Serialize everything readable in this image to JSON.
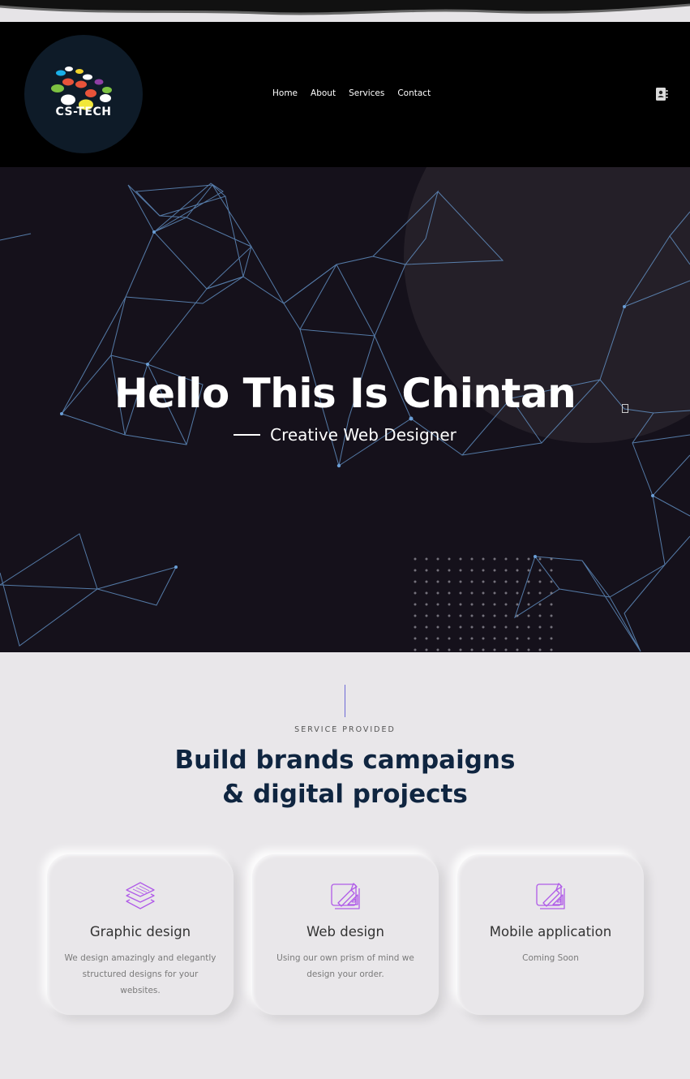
{
  "header": {
    "logo_text": "CS-TECH",
    "nav": [
      "Home",
      "About",
      "Services",
      "Contact"
    ]
  },
  "hero": {
    "title": "Hello This Is Chintan",
    "subtitle": "Creative Web Designer"
  },
  "services": {
    "eyebrow": "SERVICE PROVIDED",
    "title_line1": "Build brands campaigns",
    "title_line2": "& digital projects",
    "cards": [
      {
        "title": "Graphic design",
        "desc": "We design amazingly and elegantly structured designs for your websites.",
        "icon": "layers-icon"
      },
      {
        "title": "Web design",
        "desc": "Using our own prism of mind we design your order.",
        "icon": "blueprint-icon"
      },
      {
        "title": "Mobile application",
        "desc": "Coming Soon",
        "icon": "blueprint-icon"
      }
    ]
  },
  "colors": {
    "hero_bg": "#15111b",
    "heading": "#0f2540",
    "accent": "#b05ce8",
    "network": "#6a9ed6"
  }
}
